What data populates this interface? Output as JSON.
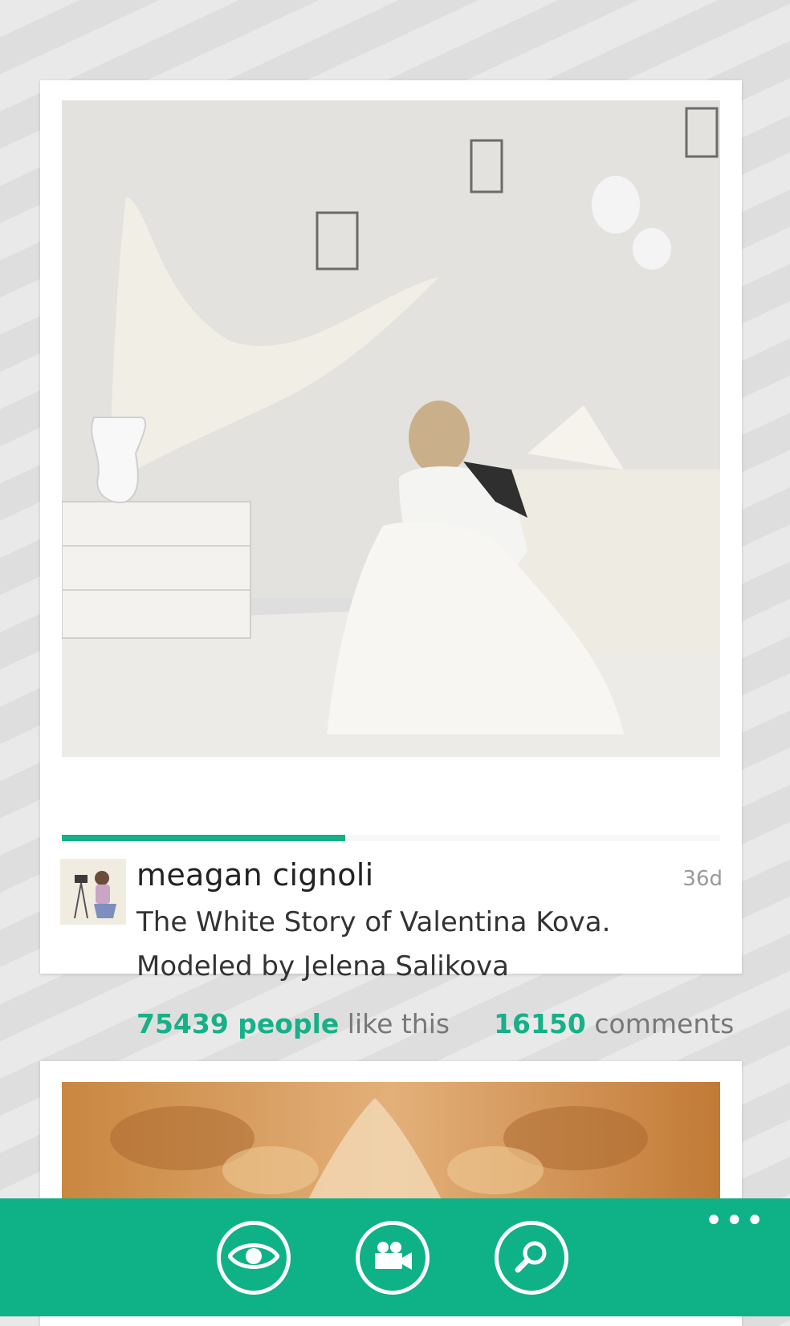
{
  "post": {
    "author": "meagan cignoli",
    "age": "36d",
    "caption_line1": "The White Story of Valentina Kova.",
    "caption_line2": "Modeled by Jelena Salikova",
    "likes_count": "75439 people",
    "likes_suffix": "like this",
    "comments_count": "16150",
    "comments_suffix": "comments",
    "video_progress": 0.43
  },
  "appbar": {
    "more_label": "•••",
    "buttons": [
      {
        "icon": "eye-icon"
      },
      {
        "icon": "video-camera-icon"
      },
      {
        "icon": "search-icon"
      }
    ]
  },
  "colors": {
    "accent": "#17b088",
    "appbar": "#0fb187"
  }
}
